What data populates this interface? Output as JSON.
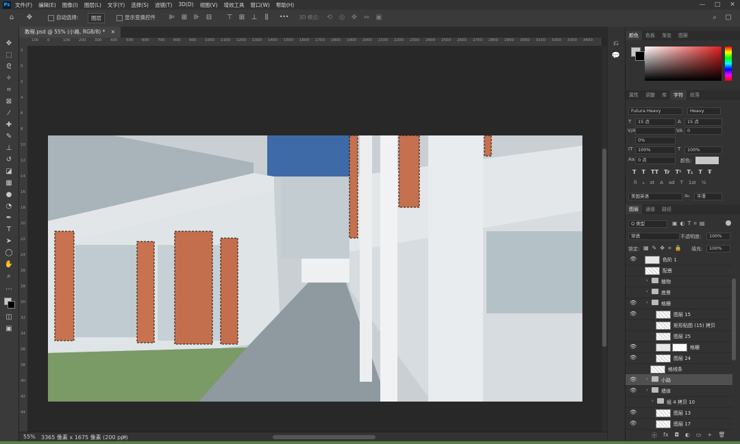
{
  "app": {
    "logo": "Ps"
  },
  "menu": [
    "文件(F)",
    "编辑(E)",
    "图像(I)",
    "图层(L)",
    "文字(Y)",
    "选择(S)",
    "滤镜(T)",
    "3D(D)",
    "视图(V)",
    "增效工具",
    "窗口(W)",
    "帮助(H)"
  ],
  "window_controls": {
    "minimize": "—",
    "maximize": "□",
    "close": "✕"
  },
  "options": {
    "auto_select_label": "自动选择:",
    "auto_select_target": "图层",
    "transform_label": "显示变换控件",
    "mode_3d_label": "3D 模式:",
    "more": "•••"
  },
  "document": {
    "tab_title": "教程.psd @ 55% (小路, RGB/8) *",
    "close": "×"
  },
  "ruler": {
    "top": [
      "100",
      "0",
      "100",
      "200",
      "300",
      "400",
      "500",
      "600",
      "700",
      "800",
      "900",
      "1000",
      "1100",
      "1200",
      "1300",
      "1400",
      "1500",
      "1600",
      "1700",
      "1800",
      "1900",
      "2000",
      "2100",
      "2200",
      "2300",
      "2400",
      "2500",
      "2600",
      "2700",
      "2800",
      "2900",
      "3000",
      "3100",
      "3200",
      "3300",
      "3400"
    ],
    "left": [
      "2",
      "0",
      "2",
      "4",
      "6",
      "8",
      "10",
      "12",
      "14",
      "16",
      "18",
      "20",
      "22",
      "24",
      "26",
      "28",
      "30",
      "32",
      "34",
      "36",
      "38",
      "40",
      "42",
      "44"
    ]
  },
  "status": {
    "zoom": "55%",
    "info": "3365 像素 x 1675 像素 (200 ppi)",
    "arrow": ">"
  },
  "color_panel": {
    "tabs": [
      "颜色",
      "色板",
      "渐变",
      "图案"
    ],
    "foreground": "#c8c8c8",
    "background": "#000000"
  },
  "char_panel": {
    "tabs": [
      "属性",
      "调整",
      "库",
      "字符",
      "段落"
    ],
    "font_family": "Futura Heavy",
    "font_style": "Heavy",
    "size": "15 点",
    "leading": "15 点",
    "va_label": "V/A",
    "kerning": "",
    "tracking": "0",
    "scale_pct": "0%",
    "vscale": "100%",
    "hscale": "100%",
    "baseline": "0 点",
    "color_label": "颜色:",
    "type_buttons": [
      "T",
      "T",
      "TT",
      "Tr",
      "T¹",
      "T₁",
      "T",
      "Ŧ"
    ],
    "ot_buttons": [
      "fi",
      "ℴ",
      "st",
      "A",
      "ad",
      "T",
      "1st",
      "½"
    ],
    "language": "美国英语",
    "aa_label": "aₐ",
    "aa": "平滑"
  },
  "layers_panel": {
    "tabs": [
      "图层",
      "通道",
      "路径"
    ],
    "filter_kind": "Q 类型",
    "blend_mode": "穿透",
    "opacity_label": "不透明度:",
    "opacity": "100%",
    "lock_label": "锁定:",
    "fill_label": "填充:",
    "fill": "100%",
    "layers": [
      {
        "name": "色阶 1",
        "visible": true,
        "type": "adjust",
        "indent": 0
      },
      {
        "name": "配景",
        "visible": false,
        "type": "smart",
        "indent": 0
      },
      {
        "name": "植物",
        "visible": false,
        "type": "folder",
        "indent": 1
      },
      {
        "name": "底景",
        "visible": false,
        "type": "folder",
        "indent": 1
      },
      {
        "name": "格栅",
        "visible": true,
        "type": "folder",
        "indent": 1
      },
      {
        "name": "图层 15",
        "visible": true,
        "type": "layer",
        "indent": 2
      },
      {
        "name": "矩形贴图 (15) 拷贝",
        "visible": false,
        "type": "layer",
        "indent": 2
      },
      {
        "name": "图层 25",
        "visible": false,
        "type": "layer",
        "indent": 2
      },
      {
        "name": "格栅",
        "visible": true,
        "type": "mask",
        "indent": 2
      },
      {
        "name": "图层 24",
        "visible": true,
        "type": "layer",
        "indent": 2
      },
      {
        "name": "格线条",
        "visible": false,
        "type": "layer",
        "indent": 1
      },
      {
        "name": "小路",
        "visible": true,
        "type": "folder",
        "indent": 1,
        "selected": true
      },
      {
        "name": "墙体",
        "visible": true,
        "type": "folder",
        "indent": 1
      },
      {
        "name": "组 4 拷贝 10",
        "visible": false,
        "type": "folder",
        "indent": 2
      },
      {
        "name": "图层 13",
        "visible": true,
        "type": "layer",
        "indent": 2
      },
      {
        "name": "图层 17",
        "visible": true,
        "type": "layer",
        "indent": 2
      }
    ],
    "footer": [
      "ⓞ",
      "fx",
      "◘",
      "◐",
      "▭",
      "+",
      "🗑"
    ]
  },
  "colors": {
    "accent": "#31a8ff",
    "selected_row": "#505050"
  }
}
